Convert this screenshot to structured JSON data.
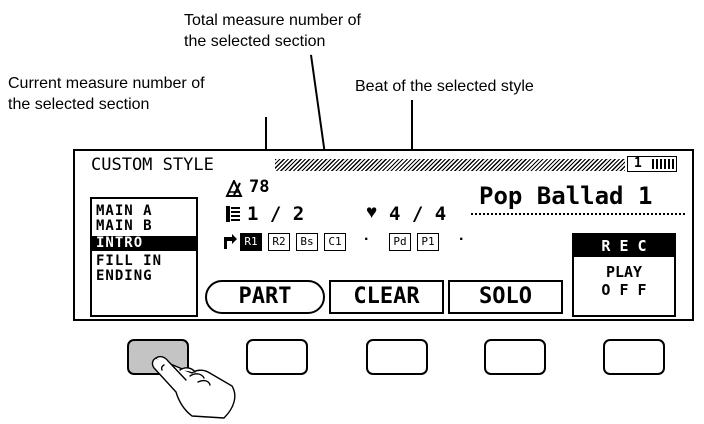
{
  "annotations": {
    "total_measure": [
      "Total measure number of",
      "the selected section"
    ],
    "current_measure": [
      "Current measure number of",
      "the selected section"
    ],
    "beat": "Beat of the selected style"
  },
  "lcd": {
    "title": "CUSTOM STYLE",
    "page_indicator": "1",
    "tempo": "78",
    "measure": "1 / 2",
    "beat": "4 / 4",
    "style_name": "Pop Ballad 1",
    "sections": [
      {
        "label": "MAIN A",
        "selected": false
      },
      {
        "label": "MAIN B",
        "selected": false
      },
      {
        "label": "INTRO",
        "selected": true
      },
      {
        "label": "FILL IN",
        "selected": false
      },
      {
        "label": "ENDING",
        "selected": false
      }
    ],
    "parts": [
      {
        "label": "R1",
        "selected": true
      },
      {
        "label": "R2",
        "selected": false
      },
      {
        "label": "Bs",
        "selected": false
      },
      {
        "label": "C1",
        "selected": false
      },
      {
        "label": "Pd",
        "selected": false
      },
      {
        "label": "P1",
        "selected": false
      }
    ],
    "softkeys": {
      "part": "PART",
      "clear": "CLEAR",
      "solo": "SOLO"
    },
    "mode": {
      "rec": "R E C",
      "play": "PLAY",
      "off": "O F F"
    }
  },
  "hardware_buttons": [
    {
      "pressed": true
    },
    {
      "pressed": false
    },
    {
      "pressed": false
    },
    {
      "pressed": false
    },
    {
      "pressed": false
    }
  ],
  "colors": {
    "pressed_button": "#c4c4c4",
    "line": "#000000",
    "background": "#ffffff"
  },
  "icons": {
    "tempo": "metronome-icon",
    "measure": "measure-icon",
    "beat": "heart-icon",
    "part_pointer": "arrow-icon",
    "hand": "hand-icon"
  }
}
